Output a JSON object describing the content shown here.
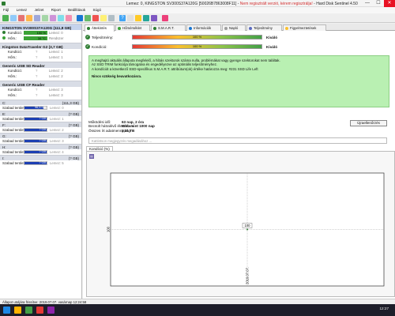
{
  "window": {
    "title": "Lemez: 0, KINGSTON SV300S37A120G [50026B7863008F11] -  ",
    "title_warning": "Nem regisztrált verzió, kérem regisztrálja!",
    "title_suffix": " -  Hard Disk Sentinel 4.50",
    "minimize": "—",
    "maximize": "☐",
    "close": "✕"
  },
  "menu": [
    "Fájl",
    "Lemez",
    "Jelzet",
    "Riport",
    "Beállítások",
    "Súgó"
  ],
  "left_panel": {
    "disks": [
      {
        "name": "KINGSTON SV300S37A120G (111,8 GB)",
        "rows": [
          {
            "label": "Kondíció:",
            "bar": "100 %",
            "value": "Lemez: 0"
          },
          {
            "label": "Hőm.:",
            "bar": "34 °C",
            "value": "Rendszer"
          }
        ]
      },
      {
        "name": "Kingston DataTraveler G2 (3,7 GB)",
        "rows": [
          {
            "label": "Kondíció:",
            "bar": "?",
            "value": "Lemez: 1"
          },
          {
            "label": "Hőm.:",
            "bar": "?",
            "value": "Lemez: 1"
          }
        ]
      },
      {
        "name": "Generic USB SD Reader",
        "rows": [
          {
            "label": "Kondíció:",
            "bar": "?",
            "value": "Lemez: 2"
          },
          {
            "label": "Hőm.:",
            "bar": "?",
            "value": "Lemez: 2"
          }
        ]
      },
      {
        "name": "Generic USB CF Reader",
        "rows": [
          {
            "label": "Kondíció:",
            "bar": "?",
            "value": "Lemez: 3"
          },
          {
            "label": "Hőm.:",
            "bar": "?",
            "value": "Lemez: 3"
          }
        ]
      }
    ],
    "partitions": [
      {
        "drive": "C:",
        "size": "(111,3 GB)",
        "free_label": "Szabad terület",
        "free": "96,5 GB",
        "disk": "Lemez: 0",
        "fill": 0.87
      },
      {
        "drive": "E:",
        "size": "(? GB)",
        "free_label": "Szabad terület",
        "free": "? GB",
        "disk": "Lemez: 1",
        "fill": 1
      },
      {
        "drive": "F:",
        "size": "(? GB)",
        "free_label": "Szabad terület",
        "free": "? GB",
        "disk": "Lemez: 2",
        "fill": 1
      },
      {
        "drive": "G:",
        "size": "(? GB)",
        "free_label": "Szabad terület",
        "free": "? GB",
        "disk": "Lemez: 3",
        "fill": 1
      },
      {
        "drive": "H:",
        "size": "(? GB)",
        "free_label": "Szabad terület",
        "free": "? GB",
        "disk": "Lemez: 4",
        "fill": 1
      },
      {
        "drive": "I:",
        "size": "(? GB)",
        "free_label": "Szabad terület",
        "free": "? GB",
        "disk": "Lemez: 5",
        "fill": 1
      }
    ]
  },
  "tabs": [
    "Áttekintés",
    "Hőmérséklet",
    "S.M.A.R.T.",
    "Információk",
    "Napló",
    "Teljesítmény",
    "Figyelmeztetések"
  ],
  "overview": {
    "performance": {
      "label": "Teljesítmény:",
      "bar": "100 %",
      "result": "Kiváló"
    },
    "condition": {
      "label": "Kondíció:",
      "bar": "100 %",
      "result": "Kiváló"
    },
    "message_lines": [
      "A meghajtó aktuális állapota megfelelő, a hibás szektorok száma nulla, problémákat vagy gyenge szektorokat nem találtak.",
      "Az SSD TRIM funkciója támogatva és engedélyezve az optimális teljesítményhez.",
      "A kondíciót a következő SSD-specifikus S.M.A.R.T. attribútum(ok) értéke határozza meg: #231 SSD Life Left"
    ],
    "message_bold": "Nincs szükség beavatkozásra.",
    "info": [
      {
        "label": "Működési idő:",
        "value": "63 nap, 2 óra"
      },
      {
        "label": "Becsült hátralévő élettartam:",
        "value": "több mint 1000 nap"
      },
      {
        "label": "Összes írt adatmennyiség:",
        "value": "3,21 TB"
      }
    ],
    "update_button": "Újraellenőrzés",
    "comment_placeholder": "Kattintson megjegyzés megadásához ...",
    "subtab": "Kondíció (%)"
  },
  "chart_data": {
    "type": "line",
    "x": [
      "2019.07.07."
    ],
    "series": [
      {
        "values": [
          100
        ]
      }
    ],
    "ylabel_ticks": [
      "100"
    ],
    "xlim_label": "2019.07.07.",
    "data_label": "100"
  },
  "statusbar": "Állapot utoljára frissítve: 2019.07.07. vasárnap 12:24:58",
  "taskbar": {
    "clock": "12:27"
  },
  "colors": {
    "accent": "#3ba236",
    "partition_fill": "#1c3fb2",
    "message_bg": "#b9f0b2"
  }
}
